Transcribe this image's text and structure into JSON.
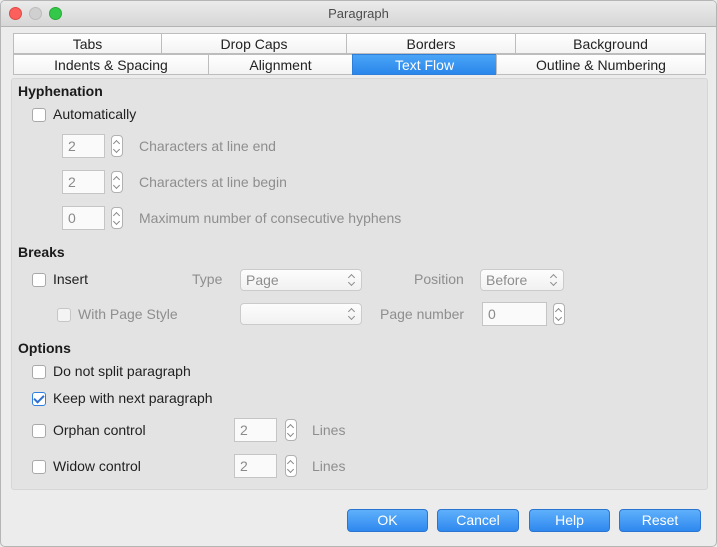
{
  "window": {
    "title": "Paragraph"
  },
  "tabs": {
    "row1": [
      "Tabs",
      "Drop Caps",
      "Borders",
      "Background"
    ],
    "row2": [
      "Indents & Spacing",
      "Alignment",
      "Text Flow",
      "Outline & Numbering"
    ],
    "active": "Text Flow"
  },
  "hyphenation": {
    "title": "Hyphenation",
    "automatically": {
      "label": "Automatically",
      "checked": false
    },
    "chars_end": {
      "value": "2",
      "label": "Characters at line end"
    },
    "chars_begin": {
      "value": "2",
      "label": "Characters at line begin"
    },
    "max_hyphens": {
      "value": "0",
      "label": "Maximum number of consecutive hyphens"
    }
  },
  "breaks": {
    "title": "Breaks",
    "insert": {
      "label": "Insert",
      "checked": false
    },
    "type_label": "Type",
    "type_value": "Page",
    "position_label": "Position",
    "position_value": "Before",
    "with_page_style": {
      "label": "With Page Style",
      "checked": false
    },
    "page_style_value": "",
    "page_number_label": "Page number",
    "page_number_value": "0"
  },
  "options": {
    "title": "Options",
    "no_split": {
      "label": "Do not split paragraph",
      "checked": false
    },
    "keep_next": {
      "label": "Keep with next paragraph",
      "checked": true
    },
    "orphan": {
      "label": "Orphan control",
      "checked": false,
      "value": "2",
      "unit": "Lines"
    },
    "widow": {
      "label": "Widow control",
      "checked": false,
      "value": "2",
      "unit": "Lines"
    }
  },
  "buttons": {
    "ok": "OK",
    "cancel": "Cancel",
    "help": "Help",
    "reset": "Reset"
  },
  "colors": {
    "accent": "#2a86ea",
    "panel": "#e3e3e3",
    "window": "#ececec"
  }
}
